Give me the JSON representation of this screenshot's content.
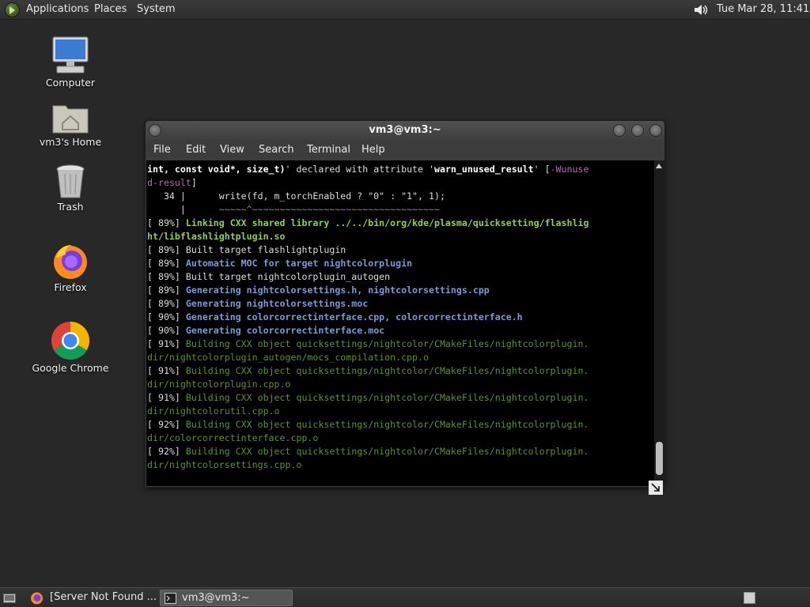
{
  "top_panel": {
    "applications": "Applications",
    "places": "Places",
    "system": "System",
    "clock": "Tue Mar 28, 11:41"
  },
  "desktop": {
    "icons": [
      {
        "label": "Computer",
        "icon": "computer-icon"
      },
      {
        "label": "vm3's Home",
        "icon": "home-folder-icon"
      },
      {
        "label": "Trash",
        "icon": "trash-icon"
      },
      {
        "label": "Firefox",
        "icon": "firefox-icon"
      },
      {
        "label": "Google Chrome",
        "icon": "chrome-icon"
      }
    ]
  },
  "terminal": {
    "title": "vm3@vm3:~",
    "menu": [
      "File",
      "Edit",
      "View",
      "Search",
      "Terminal",
      "Help"
    ],
    "lines": [
      [
        {
          "t": "int, const void*, size_t)",
          "c": "c-bold"
        },
        {
          "t": "' declared with attribute '",
          "c": "c-white"
        },
        {
          "t": "warn_unused_result",
          "c": "c-bold"
        },
        {
          "t": "' [",
          "c": "c-white"
        },
        {
          "t": "-Wunuse",
          "c": "c-magenta"
        }
      ],
      [
        {
          "t": "d-result",
          "c": "c-magenta"
        },
        {
          "t": "]",
          "c": "c-white"
        }
      ],
      [
        {
          "t": "   34 |      write(fd, m_torchEnabled ? \"0\" : \"1\", 1);",
          "c": "c-white"
        }
      ],
      [
        {
          "t": "      |      ",
          "c": "c-white"
        },
        {
          "t": "~~~~~^~~~~~~~~~~~~~~~~~~~~~~~~~~~~~~~~~~",
          "c": "c-magenta"
        }
      ],
      [
        {
          "t": "[ 89%] ",
          "c": "c-white"
        },
        {
          "t": "Linking CXX shared library ../../bin/org/kde/plasma/quicksetting/flashlig",
          "c": "c-green"
        }
      ],
      [
        {
          "t": "ht/libflashlightplugin.so",
          "c": "c-green"
        }
      ],
      [
        {
          "t": "[ 89%] Built target flashlightplugin",
          "c": "c-white"
        }
      ],
      [
        {
          "t": "[ 89%] ",
          "c": "c-white"
        },
        {
          "t": "Automatic MOC for target nightcolorplugin",
          "c": "c-blue"
        }
      ],
      [
        {
          "t": "[ 89%] Built target nightcolorplugin_autogen",
          "c": "c-white"
        }
      ],
      [
        {
          "t": "[ 89%] ",
          "c": "c-white"
        },
        {
          "t": "Generating nightcolorsettings.h, nightcolorsettings.cpp",
          "c": "c-blue"
        }
      ],
      [
        {
          "t": "[ 89%] ",
          "c": "c-white"
        },
        {
          "t": "Generating nightcolorsettings.moc",
          "c": "c-blue"
        }
      ],
      [
        {
          "t": "[ 90%] ",
          "c": "c-white"
        },
        {
          "t": "Generating colorcorrectinterface.cpp, colorcorrectinterface.h",
          "c": "c-blue"
        }
      ],
      [
        {
          "t": "[ 90%] ",
          "c": "c-white"
        },
        {
          "t": "Generating colorcorrectinterface.moc",
          "c": "c-blue"
        }
      ],
      [
        {
          "t": "[ 91%] ",
          "c": "c-white"
        },
        {
          "t": "Building CXX object quicksettings/nightcolor/CMakeFiles/nightcolorplugin.",
          "c": "c-dgreen"
        }
      ],
      [
        {
          "t": "dir/nightcolorplugin_autogen/mocs_compilation.cpp.o",
          "c": "c-dgreen"
        }
      ],
      [
        {
          "t": "[ 91%] ",
          "c": "c-white"
        },
        {
          "t": "Building CXX object quicksettings/nightcolor/CMakeFiles/nightcolorplugin.",
          "c": "c-dgreen"
        }
      ],
      [
        {
          "t": "dir/nightcolorplugin.cpp.o",
          "c": "c-dgreen"
        }
      ],
      [
        {
          "t": "[ 91%] ",
          "c": "c-white"
        },
        {
          "t": "Building CXX object quicksettings/nightcolor/CMakeFiles/nightcolorplugin.",
          "c": "c-dgreen"
        }
      ],
      [
        {
          "t": "dir/nightcolorutil.cpp.o",
          "c": "c-dgreen"
        }
      ],
      [
        {
          "t": "[ 92%] ",
          "c": "c-white"
        },
        {
          "t": "Building CXX object quicksettings/nightcolor/CMakeFiles/nightcolorplugin.",
          "c": "c-dgreen"
        }
      ],
      [
        {
          "t": "dir/colorcorrectinterface.cpp.o",
          "c": "c-dgreen"
        }
      ],
      [
        {
          "t": "[ 92%] ",
          "c": "c-white"
        },
        {
          "t": "Building CXX object quicksettings/nightcolor/CMakeFiles/nightcolorplugin.",
          "c": "c-dgreen"
        }
      ],
      [
        {
          "t": "dir/nightcolorsettings.cpp.o",
          "c": "c-dgreen"
        }
      ]
    ]
  },
  "taskbar": {
    "tasks": [
      {
        "label": "[Server Not Found ...",
        "icon": "firefox-icon"
      },
      {
        "label": "vm3@vm3:~",
        "icon": "terminal-icon"
      }
    ]
  }
}
